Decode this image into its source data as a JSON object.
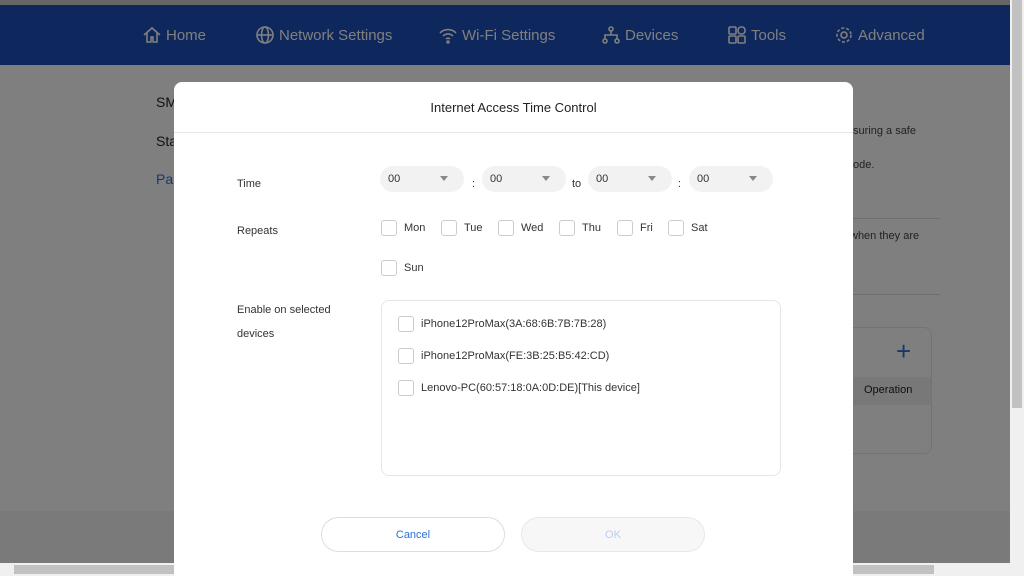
{
  "nav": {
    "items": [
      {
        "label": "Home",
        "icon": "home-icon"
      },
      {
        "label": "Network Settings",
        "icon": "globe-icon"
      },
      {
        "label": "Wi-Fi Settings",
        "icon": "wifi-icon"
      },
      {
        "label": "Devices",
        "icon": "network-tree-icon"
      },
      {
        "label": "Tools",
        "icon": "tools-grid-icon",
        "active": true
      },
      {
        "label": "Advanced",
        "icon": "gear-icon"
      }
    ]
  },
  "background": {
    "left": [
      "SM",
      "Sta",
      "Pa"
    ],
    "right": [
      "suring a safe",
      "ode.",
      "when they are"
    ],
    "operation": "Operation",
    "add_icon": "plus-icon"
  },
  "modal": {
    "title": "Internet Access Time Control",
    "time_label": "Time",
    "start_hour": "00",
    "start_min": "00",
    "to": "to",
    "end_hour": "00",
    "end_min": "00",
    "colon": ":",
    "repeats_label": "Repeats",
    "days": [
      "Mon",
      "Tue",
      "Wed",
      "Thu",
      "Fri",
      "Sat",
      "Sun"
    ],
    "devices_label_1": "Enable on selected",
    "devices_label_2": "devices",
    "devices": [
      "iPhone12ProMax(3A:68:6B:7B:7B:28)",
      "iPhone12ProMax(FE:3B:25:B5:42:CD)",
      "Lenovo-PC(60:57:18:0A:0D:DE)[This device]"
    ],
    "cancel": "Cancel",
    "ok": "OK"
  },
  "colors": {
    "nav": "#1d4fb8",
    "accent": "#2f6fd6"
  }
}
